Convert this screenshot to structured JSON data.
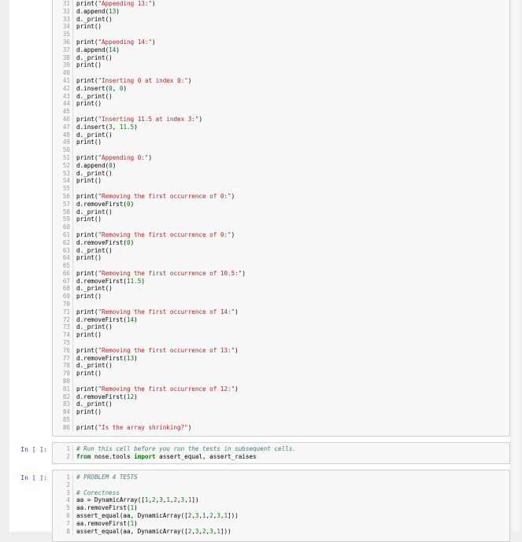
{
  "cell1": {
    "lines": [
      {
        "n": "31",
        "parts": [
          [
            "fn",
            "print("
          ],
          [
            "str",
            "\"Appending 13:\""
          ],
          [
            "fn",
            ")"
          ]
        ]
      },
      {
        "n": "32",
        "parts": [
          [
            "fn",
            "d.append("
          ],
          [
            "num",
            "13"
          ],
          [
            "fn",
            ")"
          ]
        ]
      },
      {
        "n": "33",
        "parts": [
          [
            "fn",
            "d._print()"
          ]
        ]
      },
      {
        "n": "34",
        "parts": [
          [
            "fn",
            "print()"
          ]
        ]
      },
      {
        "n": "35",
        "parts": []
      },
      {
        "n": "36",
        "parts": [
          [
            "fn",
            "print("
          ],
          [
            "str",
            "\"Appending 14:\""
          ],
          [
            "fn",
            ")"
          ]
        ]
      },
      {
        "n": "37",
        "parts": [
          [
            "fn",
            "d.append("
          ],
          [
            "num",
            "14"
          ],
          [
            "fn",
            ")"
          ]
        ]
      },
      {
        "n": "38",
        "parts": [
          [
            "fn",
            "d._print()"
          ]
        ]
      },
      {
        "n": "39",
        "parts": [
          [
            "fn",
            "print()"
          ]
        ]
      },
      {
        "n": "40",
        "parts": []
      },
      {
        "n": "41",
        "parts": [
          [
            "fn",
            "print("
          ],
          [
            "str",
            "\"Inserting 0 at index 0:\""
          ],
          [
            "fn",
            ")"
          ]
        ]
      },
      {
        "n": "42",
        "parts": [
          [
            "fn",
            "d.insert("
          ],
          [
            "num",
            "0"
          ],
          [
            "fn",
            ", "
          ],
          [
            "num",
            "0"
          ],
          [
            "fn",
            ")"
          ]
        ]
      },
      {
        "n": "43",
        "parts": [
          [
            "fn",
            "d._print()"
          ]
        ]
      },
      {
        "n": "44",
        "parts": [
          [
            "fn",
            "print()"
          ]
        ]
      },
      {
        "n": "45",
        "parts": []
      },
      {
        "n": "46",
        "parts": [
          [
            "fn",
            "print("
          ],
          [
            "str",
            "\"Inserting 11.5 at index 3:\""
          ],
          [
            "fn",
            ")"
          ]
        ]
      },
      {
        "n": "47",
        "parts": [
          [
            "fn",
            "d.insert("
          ],
          [
            "num",
            "3"
          ],
          [
            "fn",
            ", "
          ],
          [
            "num",
            "11.5"
          ],
          [
            "fn",
            ")"
          ]
        ]
      },
      {
        "n": "48",
        "parts": [
          [
            "fn",
            "d._print()"
          ]
        ]
      },
      {
        "n": "49",
        "parts": [
          [
            "fn",
            "print()"
          ]
        ]
      },
      {
        "n": "50",
        "parts": []
      },
      {
        "n": "51",
        "parts": [
          [
            "fn",
            "print("
          ],
          [
            "str",
            "\"Appending 0:\""
          ],
          [
            "fn",
            ")"
          ]
        ]
      },
      {
        "n": "52",
        "parts": [
          [
            "fn",
            "d.append("
          ],
          [
            "num",
            "0"
          ],
          [
            "fn",
            ")"
          ]
        ]
      },
      {
        "n": "53",
        "parts": [
          [
            "fn",
            "d._print()"
          ]
        ]
      },
      {
        "n": "54",
        "parts": [
          [
            "fn",
            "print()"
          ]
        ]
      },
      {
        "n": "55",
        "parts": []
      },
      {
        "n": "56",
        "parts": [
          [
            "fn",
            "print("
          ],
          [
            "str",
            "\"Removing the first occurrence of 0:\""
          ],
          [
            "fn",
            ")"
          ]
        ]
      },
      {
        "n": "57",
        "parts": [
          [
            "fn",
            "d.removeFirst("
          ],
          [
            "num",
            "0"
          ],
          [
            "fn",
            ")"
          ]
        ]
      },
      {
        "n": "58",
        "parts": [
          [
            "fn",
            "d._print()"
          ]
        ]
      },
      {
        "n": "59",
        "parts": [
          [
            "fn",
            "print()"
          ]
        ]
      },
      {
        "n": "60",
        "parts": []
      },
      {
        "n": "61",
        "parts": [
          [
            "fn",
            "print("
          ],
          [
            "str",
            "\"Removing the first occurrence of 0:\""
          ],
          [
            "fn",
            ")"
          ]
        ]
      },
      {
        "n": "62",
        "parts": [
          [
            "fn",
            "d.removeFirst("
          ],
          [
            "num",
            "0"
          ],
          [
            "fn",
            ")"
          ]
        ]
      },
      {
        "n": "63",
        "parts": [
          [
            "fn",
            "d._print()"
          ]
        ]
      },
      {
        "n": "64",
        "parts": [
          [
            "fn",
            "print()"
          ]
        ]
      },
      {
        "n": "65",
        "parts": []
      },
      {
        "n": "66",
        "parts": [
          [
            "fn",
            "print("
          ],
          [
            "str",
            "\"Removing the first occurrence of 10.5:\""
          ],
          [
            "fn",
            ")"
          ]
        ]
      },
      {
        "n": "67",
        "parts": [
          [
            "fn",
            "d.removeFirst("
          ],
          [
            "num",
            "11.5"
          ],
          [
            "fn",
            ")"
          ]
        ]
      },
      {
        "n": "68",
        "parts": [
          [
            "fn",
            "d._print()"
          ]
        ]
      },
      {
        "n": "69",
        "parts": [
          [
            "fn",
            "print()"
          ]
        ]
      },
      {
        "n": "70",
        "parts": []
      },
      {
        "n": "71",
        "parts": [
          [
            "fn",
            "print("
          ],
          [
            "str",
            "\"Removing the first occurrence of 14:\""
          ],
          [
            "fn",
            ")"
          ]
        ]
      },
      {
        "n": "72",
        "parts": [
          [
            "fn",
            "d.removeFirst("
          ],
          [
            "num",
            "14"
          ],
          [
            "fn",
            ")"
          ]
        ]
      },
      {
        "n": "73",
        "parts": [
          [
            "fn",
            "d._print()"
          ]
        ]
      },
      {
        "n": "74",
        "parts": [
          [
            "fn",
            "print()"
          ]
        ]
      },
      {
        "n": "75",
        "parts": []
      },
      {
        "n": "76",
        "parts": [
          [
            "fn",
            "print("
          ],
          [
            "str",
            "\"Removing the first occurrence of 13:\""
          ],
          [
            "fn",
            ")"
          ]
        ]
      },
      {
        "n": "77",
        "parts": [
          [
            "fn",
            "d.removeFirst("
          ],
          [
            "num",
            "13"
          ],
          [
            "fn",
            ")"
          ]
        ]
      },
      {
        "n": "78",
        "parts": [
          [
            "fn",
            "d._print()"
          ]
        ]
      },
      {
        "n": "79",
        "parts": [
          [
            "fn",
            "print()"
          ]
        ]
      },
      {
        "n": "80",
        "parts": []
      },
      {
        "n": "81",
        "parts": [
          [
            "fn",
            "print("
          ],
          [
            "str",
            "\"Removing the first occurrence of 12:\""
          ],
          [
            "fn",
            ")"
          ]
        ]
      },
      {
        "n": "82",
        "parts": [
          [
            "fn",
            "d.removeFirst("
          ],
          [
            "num",
            "12"
          ],
          [
            "fn",
            ")"
          ]
        ]
      },
      {
        "n": "83",
        "parts": [
          [
            "fn",
            "d._print()"
          ]
        ]
      },
      {
        "n": "84",
        "parts": [
          [
            "fn",
            "print()"
          ]
        ]
      },
      {
        "n": "85",
        "parts": []
      },
      {
        "n": "86",
        "parts": [
          [
            "fn",
            "print("
          ],
          [
            "str",
            "\"Is the array shrinking?\""
          ],
          [
            "fn",
            ")"
          ]
        ]
      }
    ]
  },
  "cell2": {
    "prompt": "In [ ]:",
    "lines": [
      {
        "n": "1",
        "parts": [
          [
            "cmt",
            "# Run this cell before you run the tests in subsequent cells."
          ]
        ]
      },
      {
        "n": "2",
        "parts": [
          [
            "kw",
            "from"
          ],
          [
            "fn",
            " nose.tools "
          ],
          [
            "kw",
            "import"
          ],
          [
            "fn",
            " assert_equal, assert_raises"
          ]
        ]
      }
    ]
  },
  "cell3": {
    "prompt": "In [ ]:",
    "lines": [
      {
        "n": "1",
        "parts": [
          [
            "cmt",
            "# PROBLEM 4 TESTS"
          ]
        ]
      },
      {
        "n": "2",
        "parts": []
      },
      {
        "n": "3",
        "parts": [
          [
            "cmt",
            "# Corectness"
          ]
        ]
      },
      {
        "n": "4",
        "parts": [
          [
            "fn",
            "aa = DynamicArray(["
          ],
          [
            "num",
            "1"
          ],
          [
            "fn",
            ","
          ],
          [
            "num",
            "2"
          ],
          [
            "fn",
            ","
          ],
          [
            "num",
            "3"
          ],
          [
            "fn",
            ","
          ],
          [
            "num",
            "1"
          ],
          [
            "fn",
            ","
          ],
          [
            "num",
            "2"
          ],
          [
            "fn",
            ","
          ],
          [
            "num",
            "3"
          ],
          [
            "fn",
            ","
          ],
          [
            "num",
            "1"
          ],
          [
            "fn",
            "])"
          ]
        ]
      },
      {
        "n": "5",
        "parts": [
          [
            "fn",
            "aa.removeFirst("
          ],
          [
            "num",
            "1"
          ],
          [
            "fn",
            ")"
          ]
        ]
      },
      {
        "n": "6",
        "parts": [
          [
            "fn",
            "assert_equal(aa, DynamicArray(["
          ],
          [
            "num",
            "2"
          ],
          [
            "fn",
            ","
          ],
          [
            "num",
            "3"
          ],
          [
            "fn",
            ","
          ],
          [
            "num",
            "1"
          ],
          [
            "fn",
            ","
          ],
          [
            "num",
            "2"
          ],
          [
            "fn",
            ","
          ],
          [
            "num",
            "3"
          ],
          [
            "fn",
            ","
          ],
          [
            "num",
            "1"
          ],
          [
            "fn",
            "]))"
          ]
        ]
      },
      {
        "n": "7",
        "parts": [
          [
            "fn",
            "aa.removeFirst("
          ],
          [
            "num",
            "1"
          ],
          [
            "fn",
            ")"
          ]
        ]
      },
      {
        "n": "8",
        "parts": [
          [
            "fn",
            "assert_equal(aa, DynamicArray(["
          ],
          [
            "num",
            "2"
          ],
          [
            "fn",
            ","
          ],
          [
            "num",
            "3"
          ],
          [
            "fn",
            ","
          ],
          [
            "num",
            "2"
          ],
          [
            "fn",
            ","
          ],
          [
            "num",
            "3"
          ],
          [
            "fn",
            ","
          ],
          [
            "num",
            "1"
          ],
          [
            "fn",
            "]))"
          ]
        ]
      }
    ]
  },
  "colors": {
    "prompt": "#303f9f",
    "string": "#ba2121",
    "number": "#008000",
    "keyword": "#008000",
    "comment": "#408080",
    "cell_bg": "#f7f7f7",
    "border": "#cfcfcf"
  }
}
